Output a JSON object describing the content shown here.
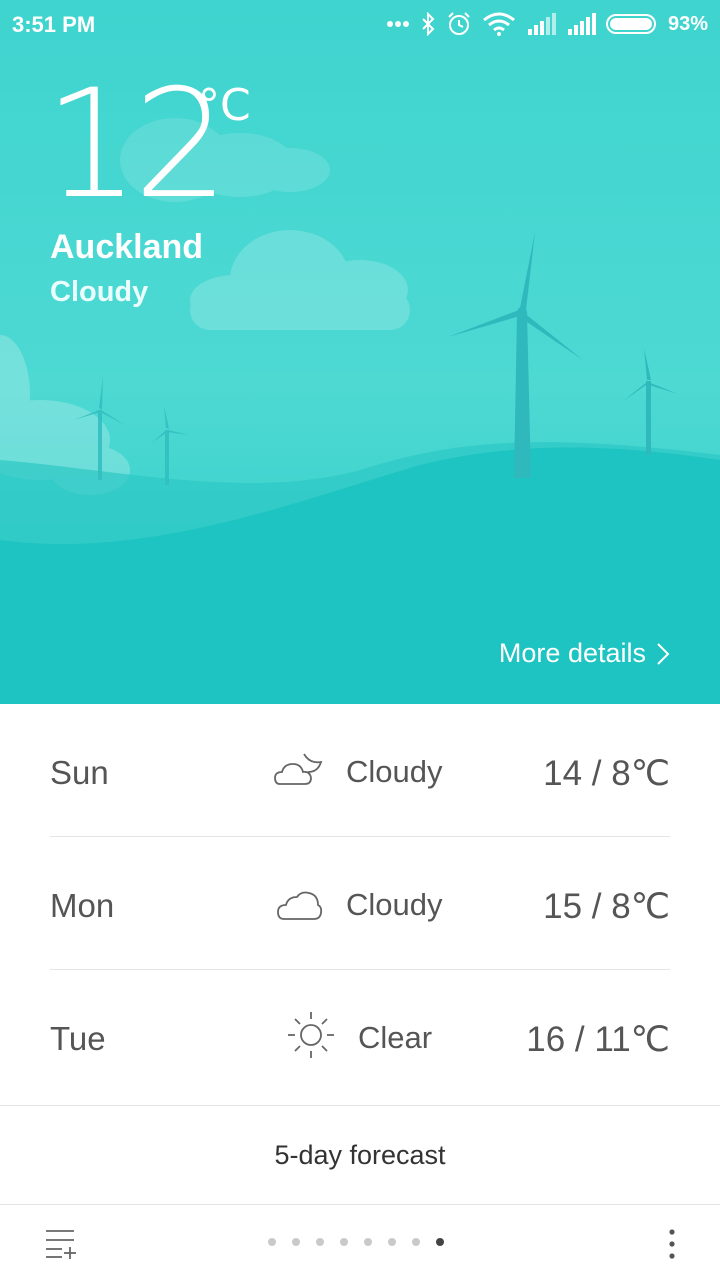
{
  "status_bar": {
    "time": "3:51 PM",
    "battery_percent": "93%",
    "icons": [
      "more-dots-icon",
      "bluetooth-icon",
      "alarm-icon",
      "wifi-icon",
      "signal-icon",
      "signal-icon",
      "battery-icon"
    ]
  },
  "current": {
    "temperature": "12",
    "unit": "°C",
    "city": "Auckland",
    "condition": "Cloudy"
  },
  "more_details_label": "More details",
  "forecast": [
    {
      "day": "Sun",
      "icon": "cloud-moon-icon",
      "condition": "Cloudy",
      "range": "14 / 8℃"
    },
    {
      "day": "Mon",
      "icon": "cloud-icon",
      "condition": "Cloudy",
      "range": "15 / 8℃"
    },
    {
      "day": "Tue",
      "icon": "sun-icon",
      "condition": "Clear",
      "range": "16 / 11℃"
    }
  ],
  "five_day_label": "5-day forecast",
  "pager": {
    "count": 8,
    "active_index": 7
  },
  "colors": {
    "sky_top": "#3fd4cf",
    "hill": "#1cc5c3",
    "text_gray": "#555555"
  }
}
